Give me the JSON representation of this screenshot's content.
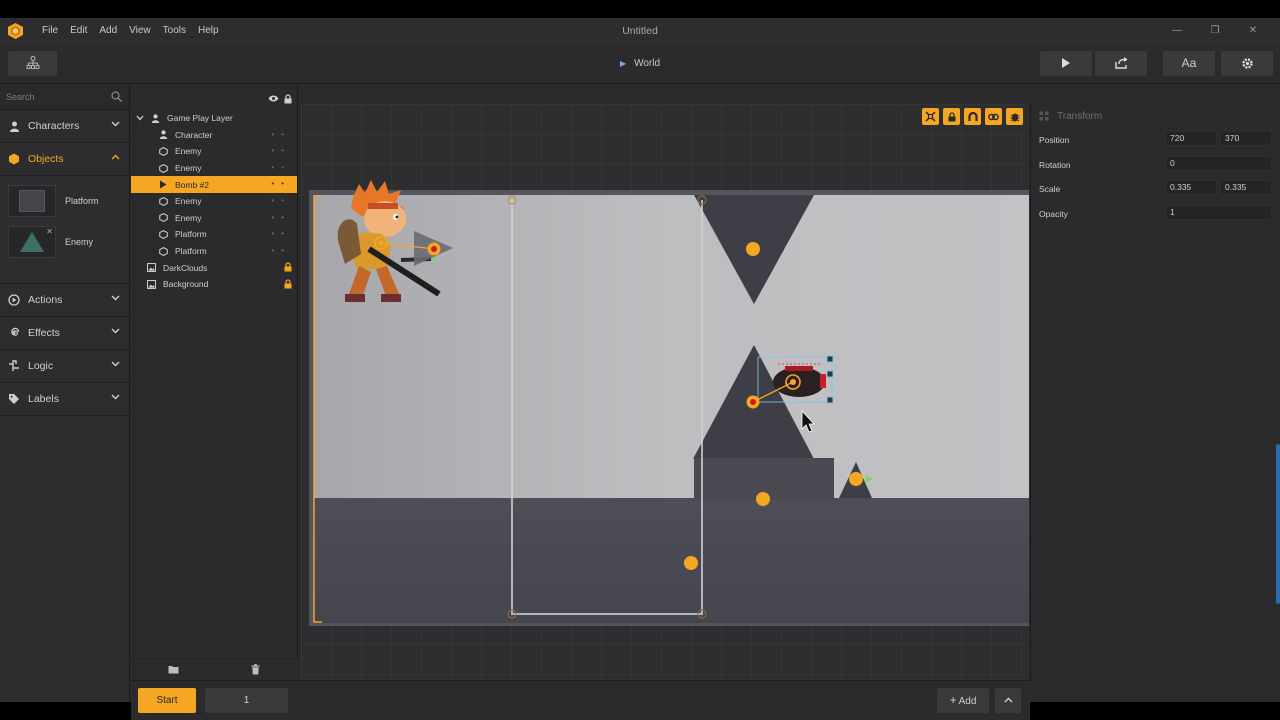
{
  "window": {
    "title": "Untitled",
    "menu": [
      "File",
      "Edit",
      "Add",
      "View",
      "Tools",
      "Help"
    ],
    "controls": [
      "minimize-icon",
      "restore-icon",
      "close-icon"
    ]
  },
  "toolbar": {
    "breadcrumb": "World",
    "font_button": "Aa"
  },
  "sidebar": {
    "search_placeholder": "Search",
    "categories": [
      {
        "label": "Characters",
        "icon": "person-icon",
        "expanded": false
      },
      {
        "label": "Objects",
        "icon": "hexagon-icon",
        "expanded": true
      },
      {
        "label": "Actions",
        "icon": "play-circle-icon",
        "expanded": false
      },
      {
        "label": "Effects",
        "icon": "swirl-icon",
        "expanded": false
      },
      {
        "label": "Logic",
        "icon": "logic-icon",
        "expanded": false
      },
      {
        "label": "Labels",
        "icon": "tag-icon",
        "expanded": false
      }
    ],
    "objects": [
      {
        "label": "Platform"
      },
      {
        "label": "Enemy"
      }
    ]
  },
  "layers": {
    "rows": [
      {
        "label": "Game Play Layer",
        "icon": "person-icon",
        "indent": 0,
        "expand": true
      },
      {
        "label": "Character",
        "icon": "person-icon",
        "indent": 1
      },
      {
        "label": "Enemy",
        "icon": "hexagon-icon",
        "indent": 1
      },
      {
        "label": "Enemy",
        "icon": "hexagon-icon",
        "indent": 1
      },
      {
        "label": "Bomb #2",
        "icon": "play-icon",
        "indent": 1,
        "selected": true
      },
      {
        "label": "Enemy",
        "icon": "hexagon-icon",
        "indent": 1
      },
      {
        "label": "Enemy",
        "icon": "hexagon-icon",
        "indent": 1
      },
      {
        "label": "Platform",
        "icon": "hexagon-icon",
        "indent": 1
      },
      {
        "label": "Platform",
        "icon": "hexagon-icon",
        "indent": 1
      },
      {
        "label": "DarkClouds",
        "icon": "image-icon",
        "indent": 0,
        "locked": true
      },
      {
        "label": "Background",
        "icon": "image-icon",
        "indent": 0,
        "locked": true
      }
    ]
  },
  "properties": {
    "section": "Transform",
    "position_label": "Position",
    "position_x": "720",
    "position_y": "370",
    "rotation_label": "Rotation",
    "rotation": "0",
    "scale_label": "Scale",
    "scale_x": "0.335",
    "scale_y": "0.335",
    "opacity_label": "Opacity",
    "opacity": "1"
  },
  "bottombar": {
    "start_label": "Start",
    "frame_value": "1",
    "add_label": "Add"
  },
  "colors": {
    "accent": "#f5a623",
    "panel": "#2b2b2d",
    "scene_light": "#b9b9bd",
    "scene_dark": "#3e3e47",
    "scene_ground": "#4a4a53"
  }
}
